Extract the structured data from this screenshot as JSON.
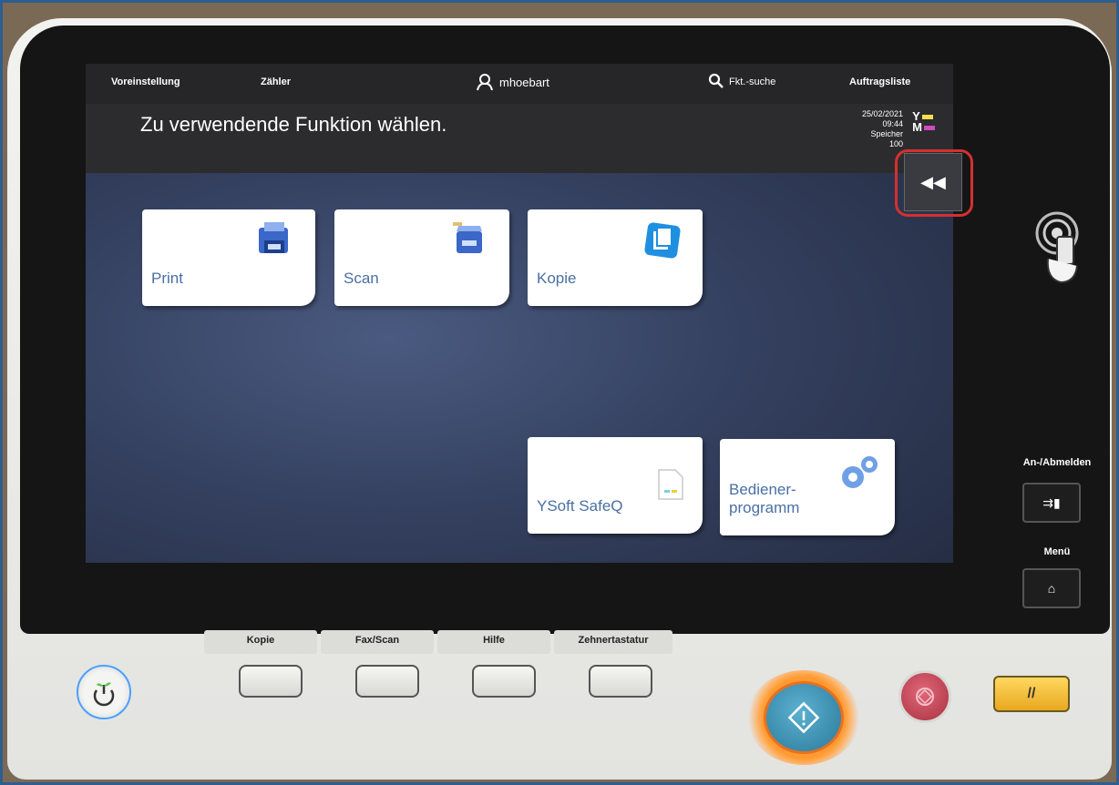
{
  "topbar": {
    "preset": "Voreinstellung",
    "counter": "Zähler",
    "user": "mhoebart",
    "search": "Fkt.-suche",
    "joblist": "Auftragsliste"
  },
  "header": {
    "title": "Zu verwendende Funktion wählen.",
    "date": "25/02/2021",
    "time": "09:44",
    "memory_label": "Speicher",
    "memory_value": "100",
    "toner_y": "Y",
    "toner_m": "M"
  },
  "tiles": {
    "print": "Print",
    "scan": "Scan",
    "copy": "Kopie",
    "ysoft": "YSoft SafeQ",
    "admin_line1": "Bediener-",
    "admin_line2": "programm"
  },
  "side": {
    "login_label": "An-/Abmelden",
    "menu_label": "Menü"
  },
  "hardware": {
    "copy": "Kopie",
    "faxscan": "Fax/Scan",
    "help": "Hilfe",
    "keypad": "Zehnertastatur"
  },
  "colors": {
    "tile_text": "#4a6fa5",
    "highlight": "#d43030",
    "start": "#3c8fb0",
    "stop": "#c84a5a",
    "reset": "#f0c030"
  }
}
